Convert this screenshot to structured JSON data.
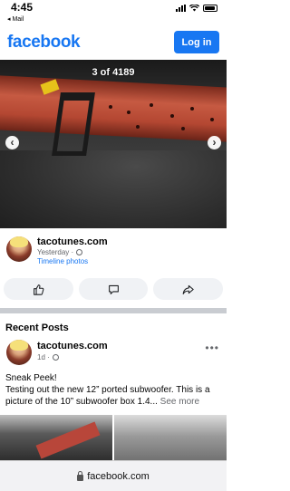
{
  "status_bar": {
    "time": "4:45",
    "back_label": "◂ Mail"
  },
  "header": {
    "logo": "facebook",
    "login_label": "Log in",
    "brand_color": "#1877f2"
  },
  "photo": {
    "counter": "3 of 4189",
    "prev_icon": "chevron-left-icon",
    "next_icon": "chevron-right-icon"
  },
  "photo_post": {
    "author": "tacotunes.com",
    "time": "Yesterday ·",
    "album": "Timeline photos"
  },
  "actions": {
    "like_icon": "thumbs-up-icon",
    "comment_icon": "comment-icon",
    "share_icon": "share-icon"
  },
  "recent_posts": {
    "title": "Recent Posts",
    "post": {
      "author": "tacotunes.com",
      "time": "1d ·",
      "text": "Sneak Peek!\nTesting out the new 12” ported subwoofer. This is a picture of the 10” subwoofer box 1.4...",
      "see_more": "See more"
    }
  },
  "browser": {
    "url": "facebook.com"
  }
}
